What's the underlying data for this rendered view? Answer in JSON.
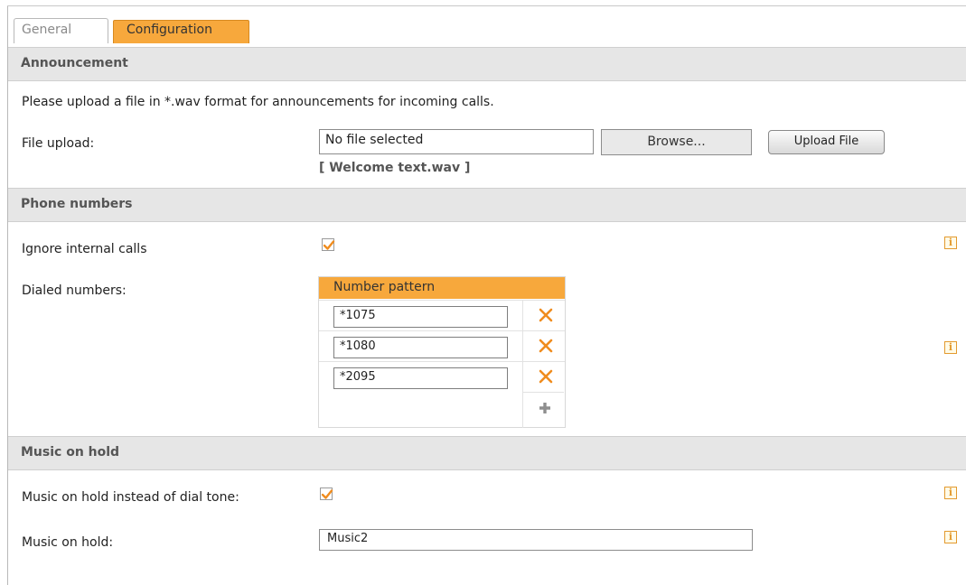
{
  "tabs": {
    "general": "General",
    "configuration": "Configuration"
  },
  "announcement": {
    "header": "Announcement",
    "description": "Please upload a file in *.wav format for announcements for incoming calls.",
    "file_upload_label": "File upload:",
    "file_input_value": "No file selected",
    "browse_label": "Browse...",
    "upload_label": "Upload File",
    "current_file": "[ Welcome text.wav ]"
  },
  "phone_numbers": {
    "header": "Phone numbers",
    "ignore_internal_label": "Ignore internal calls",
    "ignore_internal_checked": true,
    "dialed_label": "Dialed numbers:",
    "column_header": "Number pattern",
    "patterns": [
      "*1075",
      "*1080",
      "*2095"
    ]
  },
  "music": {
    "header": "Music on hold",
    "instead_label": "Music on hold instead of dial tone:",
    "instead_checked": true,
    "moh_label": "Music on hold:",
    "moh_value": "Music2"
  },
  "icons": {
    "info": "i",
    "delete": "delete-icon",
    "add": "add-icon"
  },
  "colors": {
    "accent": "#f7a83c",
    "section_bg": "#e6e6e6",
    "delete": "#f08c1e"
  }
}
